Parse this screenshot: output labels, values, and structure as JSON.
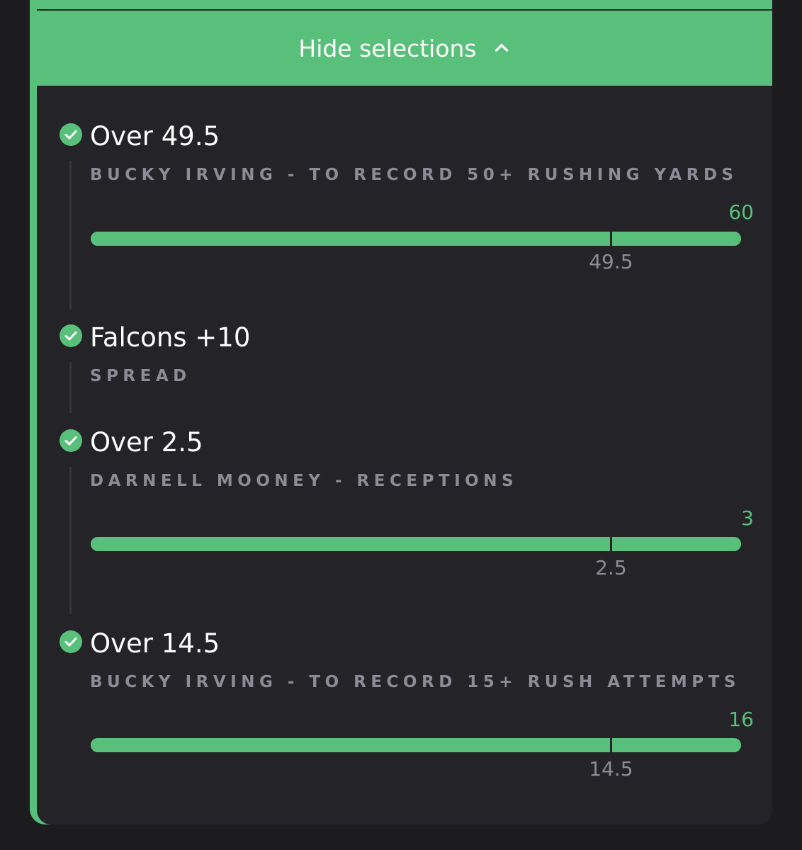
{
  "header": {
    "hide_label": "Hide selections",
    "icon": "chevron-up-icon"
  },
  "colors": {
    "accent": "#58c07a",
    "panel": "#242327",
    "page": "#1c1c1e",
    "muted": "#8d8b96"
  },
  "selections": [
    {
      "title": "Over 49.5",
      "market": "BUCKY IRVING - TO RECORD 50+ RUSHING YARDS",
      "actual": "60",
      "line": "49.5",
      "progress": 1.0,
      "line_fraction": 0.8
    },
    {
      "title": "Falcons +10",
      "market": "SPREAD"
    },
    {
      "title": "Over 2.5",
      "market": "DARNELL MOONEY - RECEPTIONS",
      "actual": "3",
      "line": "2.5",
      "progress": 1.0,
      "line_fraction": 0.8
    },
    {
      "title": "Over 14.5",
      "market": "BUCKY IRVING - TO RECORD 15+ RUSH ATTEMPTS",
      "actual": "16",
      "line": "14.5",
      "progress": 1.0,
      "line_fraction": 0.8
    }
  ]
}
